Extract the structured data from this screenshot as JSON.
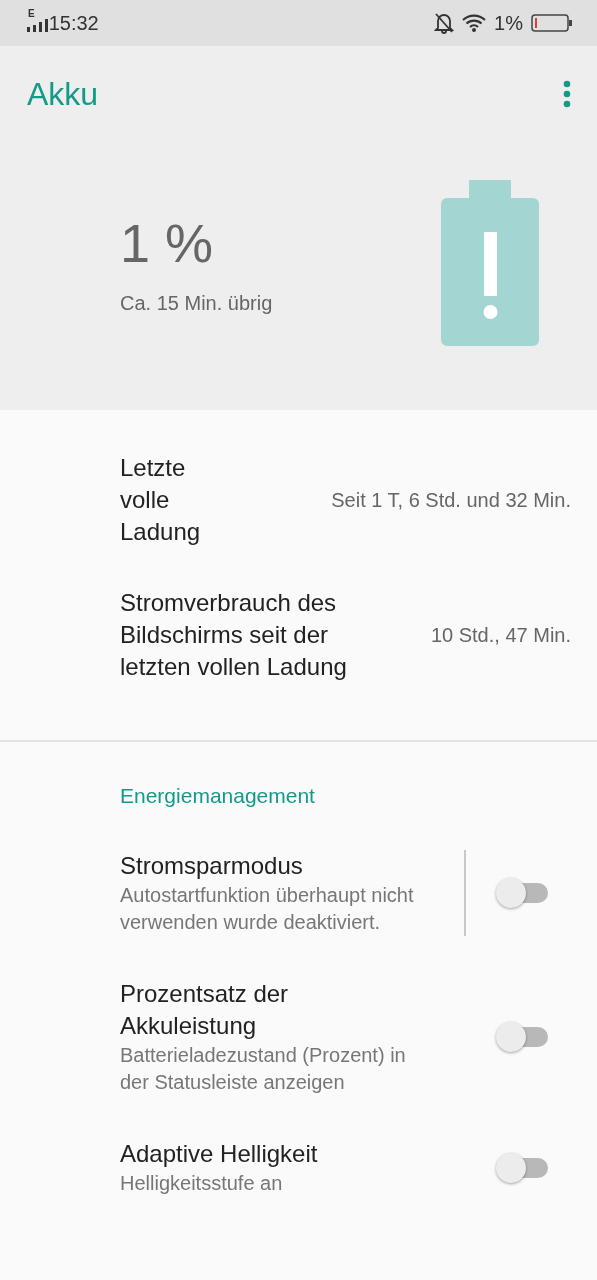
{
  "status_bar": {
    "network": "E",
    "time": "15:32",
    "battery": "1%"
  },
  "app_bar": {
    "title": "Akku"
  },
  "battery": {
    "percent": "1 %",
    "remaining": "Ca. 15 Min. übrig"
  },
  "info_rows": [
    {
      "label": "Letzte volle Ladung",
      "value": "Seit 1 T, 6 Std. und 32 Min."
    },
    {
      "label": "Stromverbrauch des Bildschirms seit der letzten vollen Ladung",
      "value": "10 Std., 47 Min."
    }
  ],
  "section": {
    "title": "Energiemanagement"
  },
  "settings": [
    {
      "title": "Stromsparmodus",
      "subtitle": "Autostartfunktion überhaupt nicht verwenden wurde deaktiviert.",
      "on": false,
      "divider": true
    },
    {
      "title": "Prozentsatz der Akkuleistung",
      "subtitle": "Batterieladezustand (Prozent) in der Statusleiste anzeigen",
      "on": false,
      "divider": false
    },
    {
      "title": "Adaptive Helligkeit",
      "subtitle": "Helligkeitsstufe an",
      "on": false,
      "divider": false
    }
  ]
}
